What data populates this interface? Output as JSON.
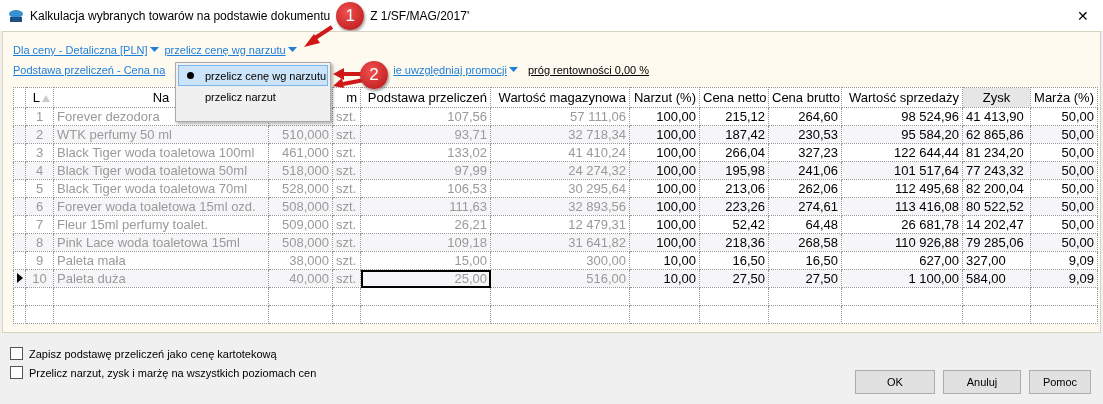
{
  "window": {
    "title": "Kalkulacja wybranych towarów na podstawie dokumentu",
    "title_tail": "Z 1/SF/MAG/2017'",
    "close": "✕"
  },
  "links_row_1": [
    {
      "label": "Dla ceny - Detaliczna [PLN]",
      "dropdown": true
    },
    {
      "label": "przelicz cenę wg narzutu",
      "dropdown": true
    }
  ],
  "links_row_2": [
    {
      "label": "Podstawa przeliczeń - Cena na",
      "dropdown": false
    },
    {
      "label": "ie uwzględniaj promocji",
      "dropdown": true
    }
  ],
  "threshold": "próg rentowności 0,00 %",
  "menu": {
    "items": [
      {
        "label": "przelicz cenę wg narzutu",
        "selected": true
      },
      {
        "label": "przelicz narzut",
        "selected": false
      }
    ]
  },
  "table": {
    "columns": [
      {
        "label": "L",
        "kind": "index",
        "muted": true,
        "sorted": true
      },
      {
        "label": "Na",
        "kind": "text",
        "muted": true,
        "sorted": false
      },
      {
        "kind": "number",
        "muted": true,
        "sorted": false
      },
      {
        "label": "m",
        "kind": "unit",
        "muted": true,
        "sorted": false
      },
      {
        "label": "Podstawa przeliczeń",
        "kind": "number",
        "muted": true,
        "sorted": false,
        "current": true
      },
      {
        "label": "Wartość magazynowa",
        "kind": "number",
        "muted": true,
        "sorted": false
      },
      {
        "label": "Narzut (%)",
        "kind": "number",
        "muted": false,
        "sorted": false
      },
      {
        "label": "Cena netto",
        "kind": "number",
        "muted": false,
        "sorted": false
      },
      {
        "label": "Cena brutto",
        "kind": "number",
        "muted": false,
        "sorted": false
      },
      {
        "label": "Wartość sprzedaży",
        "kind": "number",
        "muted": false,
        "sorted": false
      },
      {
        "label": "Zysk",
        "kind": "text",
        "muted": false,
        "sorted": false,
        "highlighted": true
      },
      {
        "label": "Marża (%)",
        "kind": "number",
        "muted": false,
        "sorted": false
      }
    ],
    "rows": [
      {
        "selected": false,
        "cells": [
          "1",
          "Forever dezodora",
          null,
          "szt.",
          "107,56",
          "57 111,06",
          "100,00",
          "215,12",
          "264,60",
          "98 524,96",
          "41 413,90",
          "50,00"
        ]
      },
      {
        "selected": false,
        "cells": [
          "2",
          "WTK perfumy 50 ml",
          "510,000",
          "szt.",
          "93,71",
          "32 718,34",
          "100,00",
          "187,42",
          "230,53",
          "95 584,20",
          "62 865,86",
          "50,00"
        ]
      },
      {
        "selected": false,
        "cells": [
          "3",
          "Black Tiger woda toaletowa 100ml",
          "461,000",
          "szt.",
          "133,02",
          "41 410,24",
          "100,00",
          "266,04",
          "327,23",
          "122 644,44",
          "81 234,20",
          "50,00"
        ]
      },
      {
        "selected": false,
        "cells": [
          "4",
          "Black Tiger woda toaletowa 50ml",
          "518,000",
          "szt.",
          "97,99",
          "24 274,32",
          "100,00",
          "195,98",
          "241,06",
          "101 517,64",
          "77 243,32",
          "50,00"
        ]
      },
      {
        "selected": false,
        "cells": [
          "5",
          "Black Tiger woda toaletowa 70ml",
          "528,000",
          "szt.",
          "106,53",
          "30 295,64",
          "100,00",
          "213,06",
          "262,06",
          "112 495,68",
          "82 200,04",
          "50,00"
        ]
      },
      {
        "selected": false,
        "cells": [
          "6",
          "Forever woda toaletowa 15ml ozd.",
          "508,000",
          "szt.",
          "111,63",
          "32 893,56",
          "100,00",
          "223,26",
          "274,61",
          "113 416,08",
          "80 522,52",
          "50,00"
        ]
      },
      {
        "selected": false,
        "cells": [
          "7",
          "Fleur 15ml perfumy toalet.",
          "509,000",
          "szt.",
          "26,21",
          "12 479,31",
          "100,00",
          "52,42",
          "64,48",
          "26 681,78",
          "14 202,47",
          "50,00"
        ]
      },
      {
        "selected": false,
        "cells": [
          "8",
          "Pink Lace woda toaletowa 15ml",
          "508,000",
          "szt.",
          "109,18",
          "31 641,82",
          "100,00",
          "218,36",
          "268,58",
          "110 926,88",
          "79 285,06",
          "50,00"
        ]
      },
      {
        "selected": false,
        "cells": [
          "9",
          "Paleta mała",
          "38,000",
          "szt.",
          "15,00",
          "300,00",
          "10,00",
          "16,50",
          "16,50",
          "627,00",
          "327,00",
          "9,09"
        ]
      },
      {
        "selected": true,
        "cells": [
          "10",
          "Paleta duża",
          "40,000",
          "szt.",
          "25,00",
          "516,00",
          "10,00",
          "27,50",
          "27,50",
          "1 100,00",
          "584,00",
          "9,09"
        ]
      }
    ]
  },
  "options": [
    {
      "label": "Zapisz podstawę przeliczeń jako cenę kartotekową",
      "checked": false
    },
    {
      "label": "Przelicz narzut, zysk i marżę na wszystkich poziomach cen",
      "checked": false
    }
  ],
  "buttons": [
    "OK",
    "Anuluj",
    "Pomoc"
  ],
  "annotations": [
    {
      "label": "1"
    },
    {
      "label": "2"
    }
  ]
}
